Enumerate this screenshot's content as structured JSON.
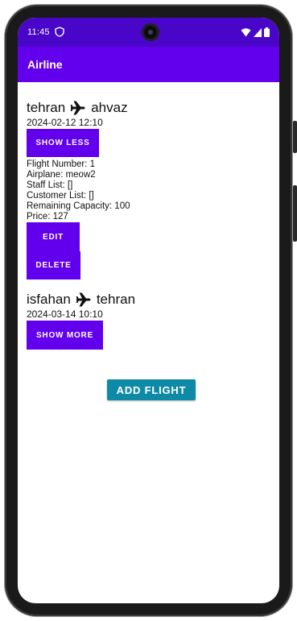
{
  "status_bar": {
    "time": "11:45",
    "icons": [
      "shield-icon",
      "wifi-icon",
      "signal-icon",
      "battery-icon"
    ]
  },
  "app_bar": {
    "title": "Airline"
  },
  "flights": [
    {
      "origin": "tehran",
      "destination": "ahvaz",
      "datetime": "2024-02-12 12:10",
      "toggle_label": "SHOW LESS",
      "details": {
        "flight_number": "Flight Number: 1",
        "airplane": "Airplane: meow2",
        "staff_list": "Staff List: []",
        "customer_list": "Customer List: []",
        "remaining_capacity": "Remaining Capacity: 100",
        "price": "Price: 127"
      },
      "edit_label": "EDIT",
      "delete_label": "DELETE"
    },
    {
      "origin": "isfahan",
      "destination": "tehran",
      "datetime": "2024-03-14 10:10",
      "toggle_label": "SHOW MORE"
    }
  ],
  "add_flight_label": "ADD FLIGHT",
  "colors": {
    "status_bar": "#4a06c8",
    "primary": "#6200ee",
    "accent_button": "#0f8aa6",
    "text": "#111111"
  }
}
